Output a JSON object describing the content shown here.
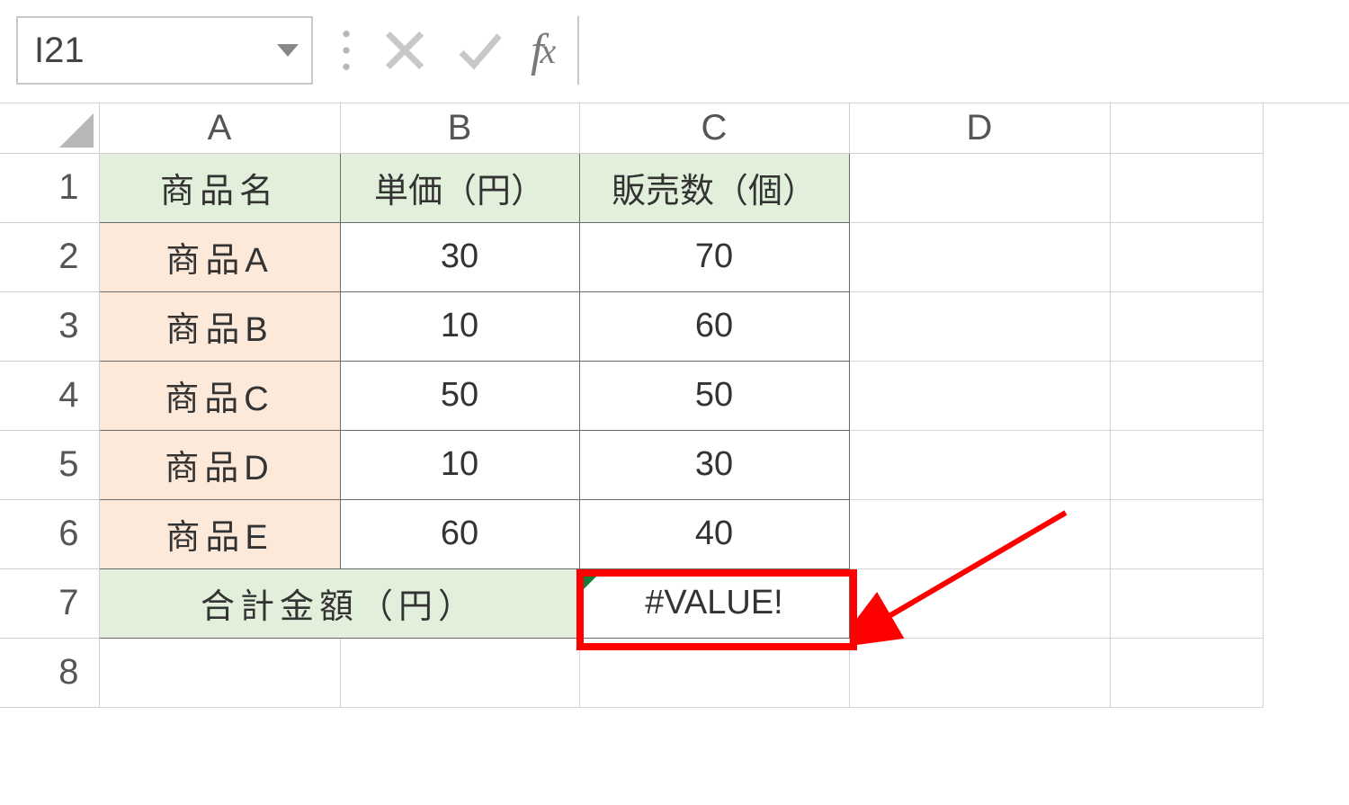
{
  "formula_bar": {
    "name_box": "I21",
    "formula": ""
  },
  "columns": [
    "A",
    "B",
    "C",
    "D"
  ],
  "rows": [
    "1",
    "2",
    "3",
    "4",
    "5",
    "6",
    "7",
    "8"
  ],
  "table": {
    "headers": {
      "A": "商品名",
      "B": "単価（円）",
      "C": "販売数（個）"
    },
    "data": [
      {
        "name": "商品A",
        "price": "30",
        "qty": "70"
      },
      {
        "name": "商品B",
        "price": "10",
        "qty": "60"
      },
      {
        "name": "商品C",
        "price": "50",
        "qty": "50"
      },
      {
        "name": "商品D",
        "price": "10",
        "qty": "30"
      },
      {
        "name": "商品E",
        "price": "60",
        "qty": "40"
      }
    ],
    "sum_label": "合計金額（円）",
    "sum_value": "#VALUE!"
  },
  "annotation": {
    "highlight_cell": "C7",
    "arrow": true
  }
}
